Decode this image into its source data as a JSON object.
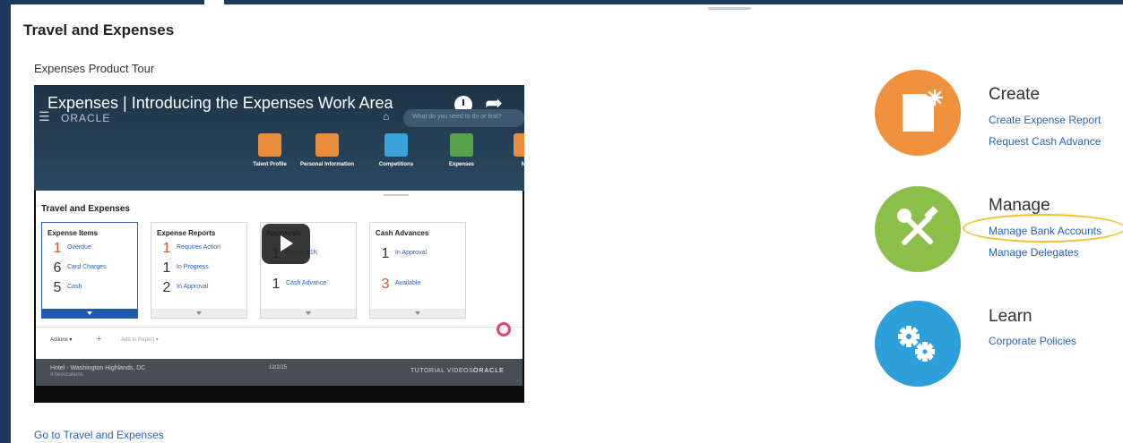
{
  "page": {
    "title": "Travel and Expenses",
    "tour_title": "Expenses Product Tour",
    "go_link": "Go to Travel and Expenses"
  },
  "video": {
    "title": "Expenses | Introducing the Expenses Work Area",
    "brand": "ORACLE",
    "search_placeholder": "What do you need to do or find?",
    "apps": [
      {
        "label": "Talent Profile",
        "color": "#e88d3b"
      },
      {
        "label": "Personal Information",
        "color": "#e88d3b"
      },
      {
        "label": "Competitions",
        "color": "#3aa3d9"
      },
      {
        "label": "Expenses",
        "color": "#57a14a"
      },
      {
        "label": "My",
        "color": "#e88d3b"
      }
    ],
    "panel_title": "Travel and Expenses",
    "cards": [
      {
        "title": "Expense Items",
        "rows": [
          {
            "num": "1",
            "label": "Overdue",
            "color": "#d9542b"
          },
          {
            "num": "6",
            "label": "Card Charges",
            "color": "#333333"
          },
          {
            "num": "5",
            "label": "Cash",
            "color": "#333333"
          }
        ]
      },
      {
        "title": "Expense Reports",
        "rows": [
          {
            "num": "1",
            "label": "Requires Action",
            "color": "#d9542b"
          },
          {
            "num": "1",
            "label": "In Progress",
            "color": "#333333"
          },
          {
            "num": "2",
            "label": "In Approval",
            "color": "#333333"
          }
        ]
      },
      {
        "title": "Approvals",
        "rows": [
          {
            "num": "1",
            "label": "Report $1K",
            "color": "#333333"
          },
          {
            "num": "1",
            "label": "Cash Advance",
            "color": "#333333"
          }
        ]
      },
      {
        "title": "Cash Advances",
        "rows": [
          {
            "num": "1",
            "label": "In Approval",
            "color": "#333333"
          },
          {
            "num": "3",
            "label": "Available",
            "color": "#d9542b"
          }
        ]
      }
    ],
    "actions_label": "Actions ▾",
    "add_to_report": "Add to Report ▾",
    "hotel": "Hotel - Washington Highlands, DC",
    "hotel_sub": "4 itemizations",
    "date": "12/2/15",
    "tutorial": "TUTORIAL VIDEOS"
  },
  "sections": {
    "create": {
      "title": "Create",
      "icon": "document-sparkle-icon",
      "color": "#f0913d",
      "links": [
        "Create Expense Report",
        "Request Cash Advance"
      ]
    },
    "manage": {
      "title": "Manage",
      "icon": "tools-icon",
      "color": "#8cc04b",
      "links": [
        "Manage Bank Accounts",
        "Manage Delegates"
      ]
    },
    "learn": {
      "title": "Learn",
      "icon": "gears-icon",
      "color": "#2d9fd9",
      "links": [
        "Corporate Policies"
      ]
    }
  },
  "highlight_color": "#f2c12e"
}
